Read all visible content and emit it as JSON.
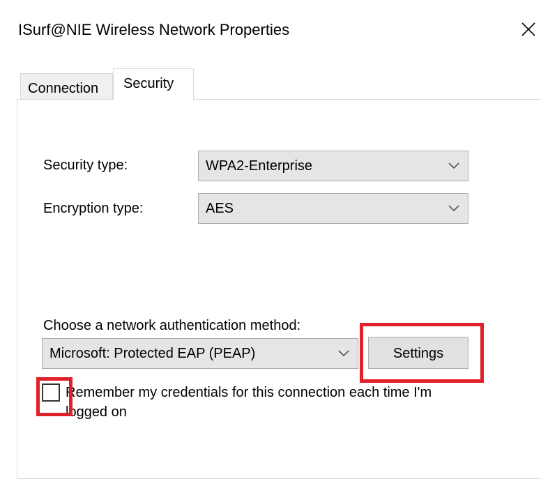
{
  "window": {
    "title": "ISurf@NIE Wireless Network Properties"
  },
  "tabs": [
    {
      "label": "Connection",
      "selected": false
    },
    {
      "label": "Security",
      "selected": true
    }
  ],
  "security": {
    "security_type_label": "Security type:",
    "security_type_value": "WPA2-Enterprise",
    "encryption_type_label": "Encryption type:",
    "encryption_type_value": "AES",
    "auth_method_label": "Choose a network authentication method:",
    "auth_method_value": "Microsoft: Protected EAP (PEAP)",
    "settings_button": "Settings",
    "remember_label": "Remember my credentials for this connection each time I'm logged on",
    "remember_checked": false
  },
  "annotations": {
    "highlight_color": "#e0202a"
  },
  "icons": {
    "close": "close-icon",
    "dropdown": "chevron-down-icon"
  }
}
